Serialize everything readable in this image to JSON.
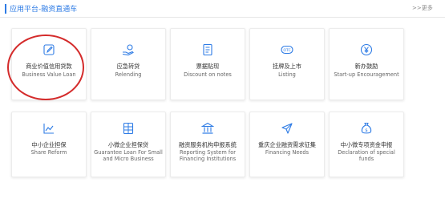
{
  "header": {
    "title": "应用平台-融资直通车",
    "more": ">>更多"
  },
  "cards": [
    {
      "zh": "商业价值信用贷款",
      "en": "Business Value Loan",
      "icon": "edit-icon"
    },
    {
      "zh": "应急转贷",
      "en": "Relending",
      "icon": "hand-coin-icon"
    },
    {
      "zh": "票据贴现",
      "en": "Discount on notes",
      "icon": "document-icon"
    },
    {
      "zh": "挂牌及上市",
      "en": "Listing",
      "icon": "otc-icon"
    },
    {
      "zh": "新办鼓励",
      "en": "Start-up Encouragement",
      "icon": "yen-icon"
    },
    {
      "zh": "中小企业担保",
      "en": "Share Reform",
      "icon": "line-chart-icon"
    },
    {
      "zh": "小微企业担保贷",
      "en": "Guarantee Loan For Small and Micro Business",
      "icon": "grid-document-icon"
    },
    {
      "zh": "融资服务机构申报系统",
      "en": "Reporting System for Financing Institutions",
      "icon": "bank-icon"
    },
    {
      "zh": "重庆企业融资需求征集",
      "en": "Financing Needs",
      "icon": "send-icon"
    },
    {
      "zh": "中小微专项资金申报",
      "en": "Declaration of special funds",
      "icon": "money-bag-icon"
    }
  ],
  "colors": {
    "accent": "#2d7be5",
    "highlight": "#d42b2b"
  }
}
